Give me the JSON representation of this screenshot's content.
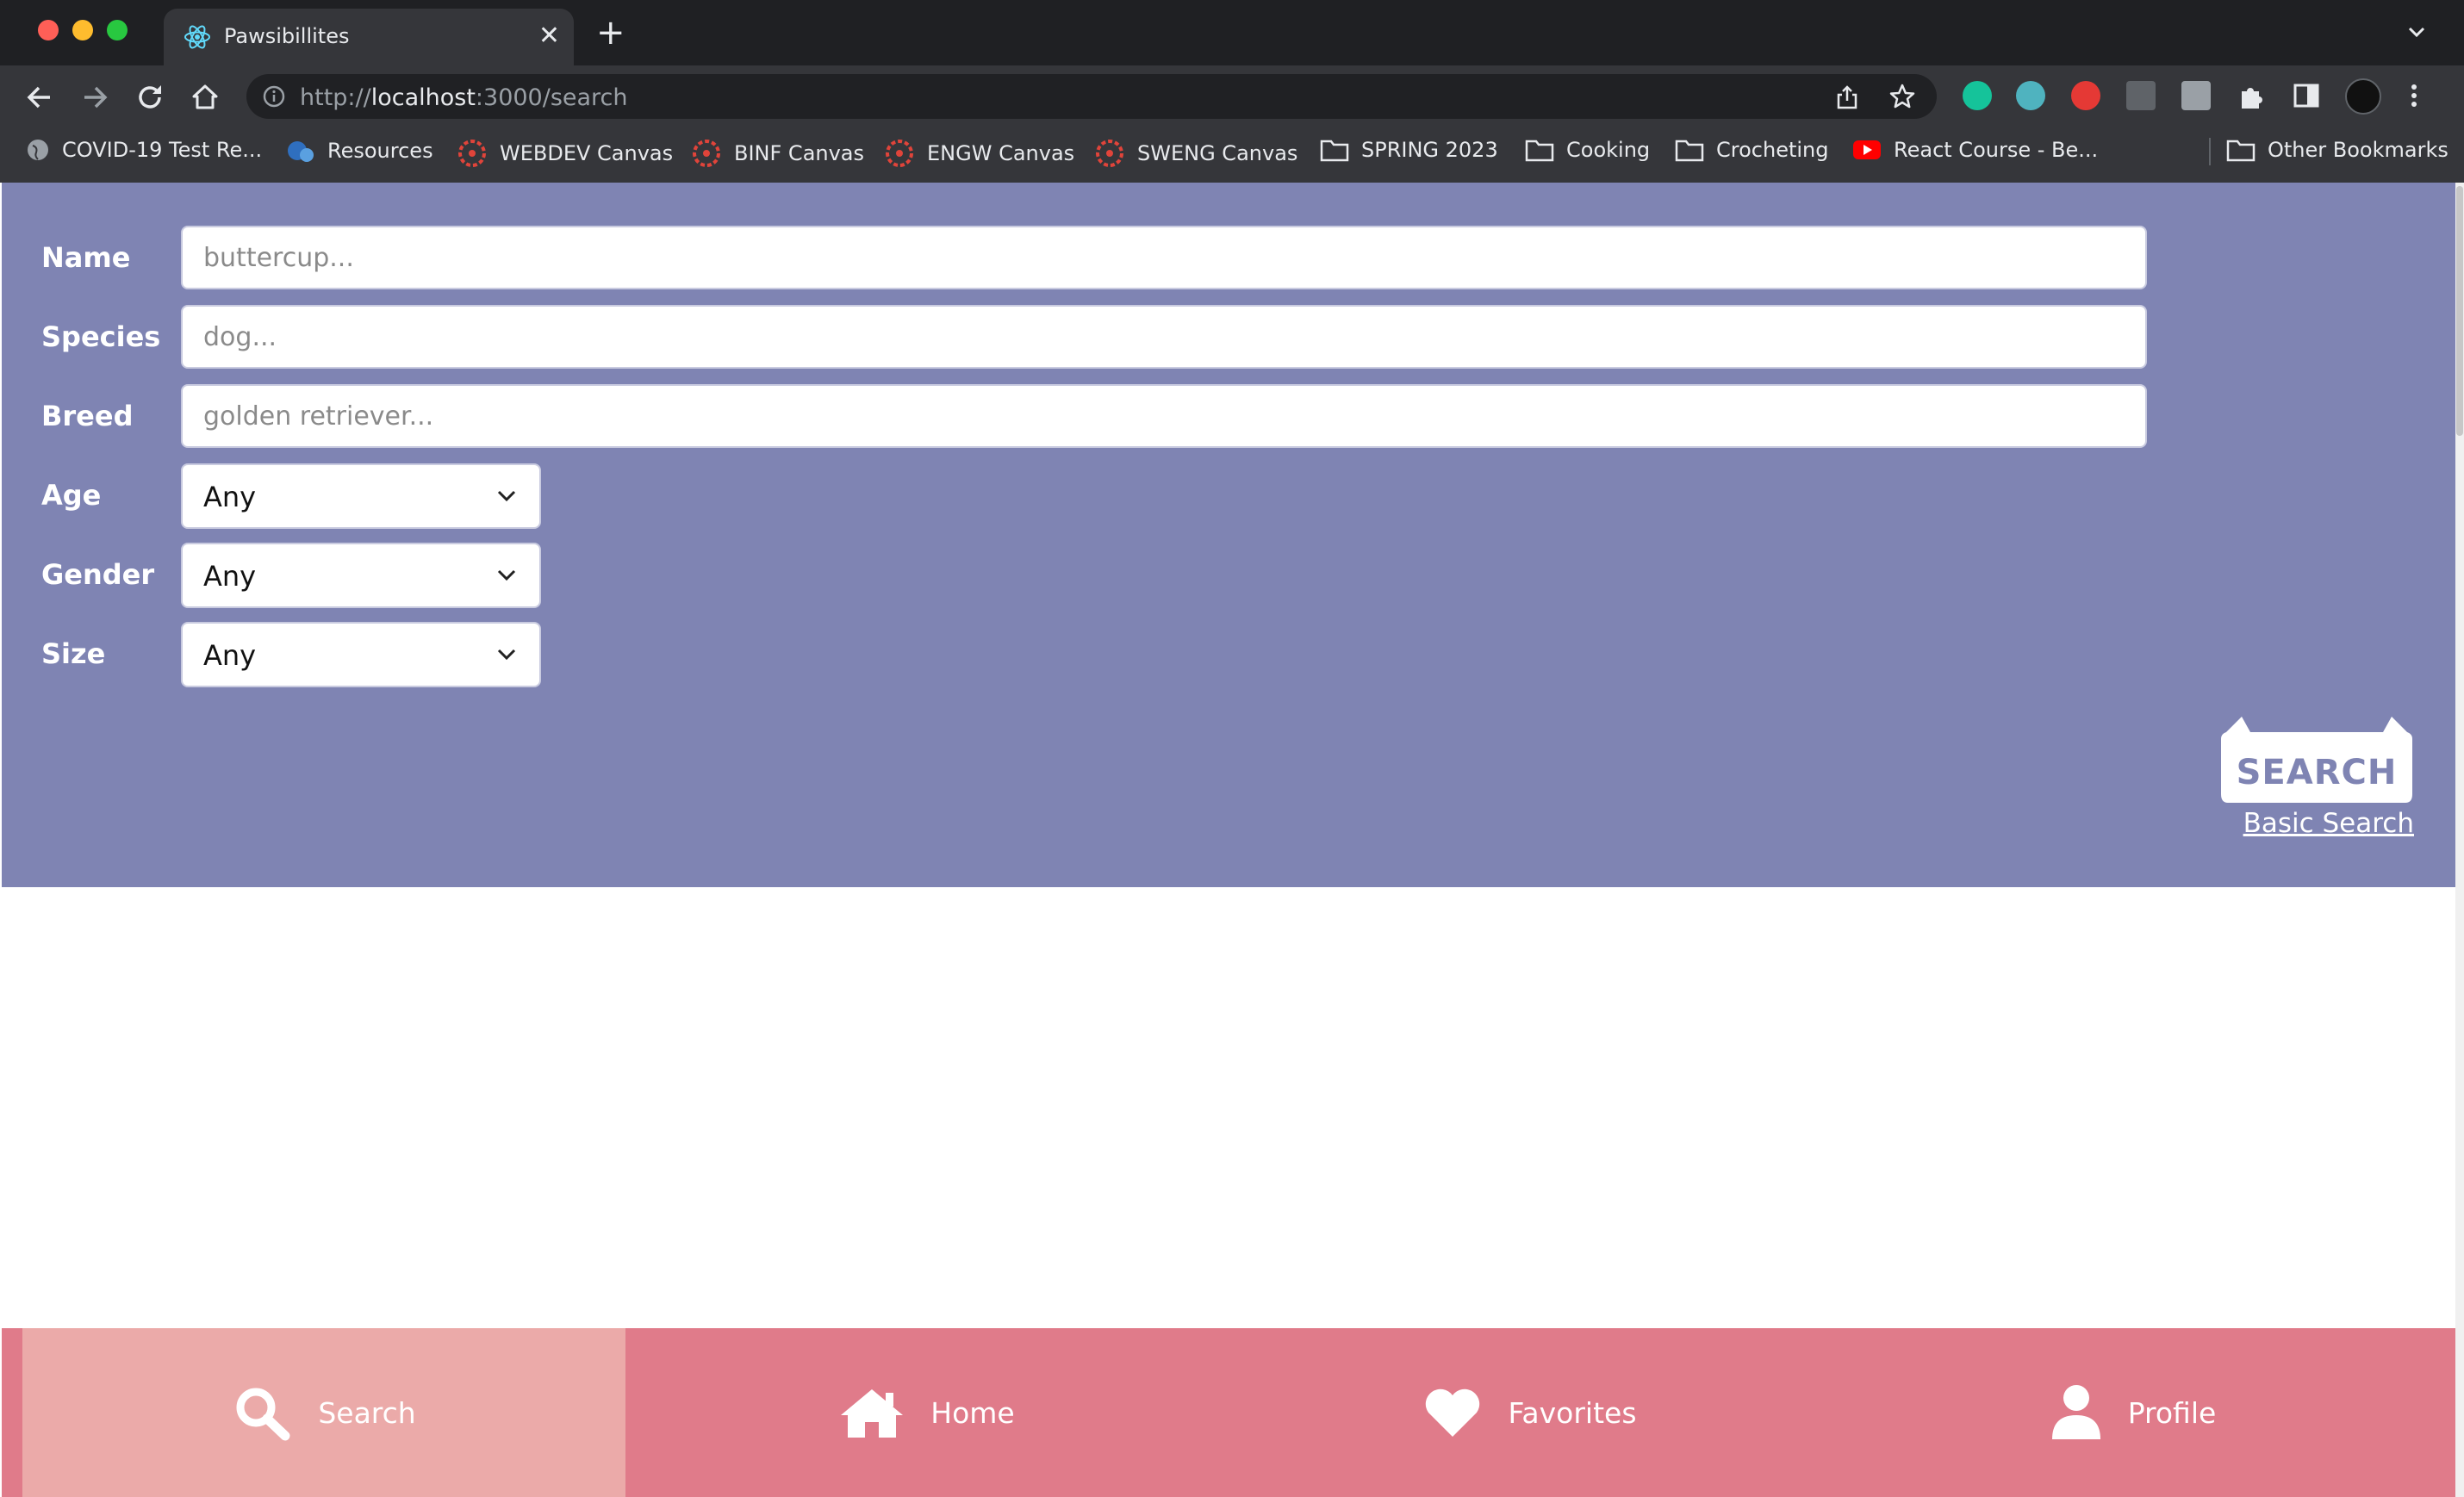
{
  "browser": {
    "tab_title": "Pawsibillites",
    "new_tab_label": "+",
    "close_label": "✕",
    "url": {
      "scheme": "http://",
      "host": "localhost",
      "rest": ":3000/search"
    },
    "bookmarks": [
      {
        "label": "COVID-19 Test Re...",
        "icon": "globe-icon"
      },
      {
        "label": "Resources",
        "icon": "s-logo-icon"
      },
      {
        "label": "WEBDEV Canvas",
        "icon": "canvas-icon"
      },
      {
        "label": "BINF Canvas",
        "icon": "canvas-icon"
      },
      {
        "label": "ENGW Canvas",
        "icon": "canvas-icon"
      },
      {
        "label": "SWENG Canvas",
        "icon": "canvas-icon"
      },
      {
        "label": "SPRING 2023",
        "icon": "folder-icon"
      },
      {
        "label": "Cooking",
        "icon": "folder-icon"
      },
      {
        "label": "Crocheting",
        "icon": "folder-icon"
      },
      {
        "label": "React Course - Be...",
        "icon": "youtube-icon"
      }
    ],
    "other_bookmarks": "Other Bookmarks",
    "colors": {
      "tabstrip": "#1f2023",
      "toolbar": "#35363a"
    }
  },
  "form": {
    "name": {
      "label": "Name",
      "placeholder": "buttercup..."
    },
    "species": {
      "label": "Species",
      "placeholder": "dog..."
    },
    "breed": {
      "label": "Breed",
      "placeholder": "golden retriever..."
    },
    "age": {
      "label": "Age",
      "value": "Any"
    },
    "gender": {
      "label": "Gender",
      "value": "Any"
    },
    "size": {
      "label": "Size",
      "value": "Any"
    },
    "search_button": "SEARCH",
    "basic_search_link": "Basic Search",
    "colors": {
      "panel": "#7f84b3"
    }
  },
  "bottom_nav": {
    "items": [
      {
        "label": "Search",
        "icon": "search-icon",
        "active": true
      },
      {
        "label": "Home",
        "icon": "home-icon",
        "active": false
      },
      {
        "label": "Favorites",
        "icon": "heart-icon",
        "active": false
      },
      {
        "label": "Profile",
        "icon": "user-icon",
        "active": false
      }
    ],
    "colors": {
      "bar": "#e07b8a",
      "active": "#ebaaa9"
    }
  }
}
